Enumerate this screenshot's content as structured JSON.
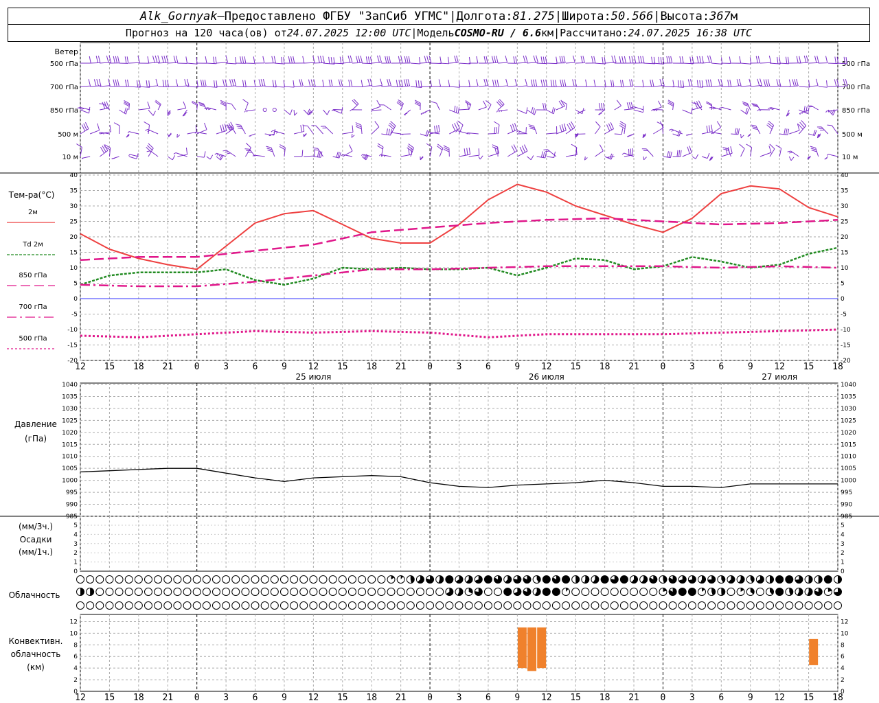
{
  "header": {
    "station": "Alk_Gornyak",
    "dash": " – ",
    "provider": "Предоставлено ФГБУ \"ЗапСиб УГМС\"",
    "sep": " | ",
    "lon_label": "Долгота: ",
    "lon": "81.275",
    "lat_label": "Широта: ",
    "lat": "50.566",
    "alt_label": "Высота: ",
    "alt": "367",
    "alt_unit": "м",
    "forecast_label": "Прогноз на 120 часа(ов) от ",
    "init_time": "24.07.2025 12:00 UTC",
    "model_label": "Модель ",
    "model": "COSMO-RU / 6.6",
    "model_unit": "км",
    "calc_label": "Рассчитано: ",
    "calc_time": "24.07.2025 16:38 UTC"
  },
  "chart_data": [
    {
      "type": "wind_barbs",
      "panel_title": "Ветер",
      "levels": [
        "500 гПа",
        "700 гПа",
        "850 гПа",
        "500 м",
        "10 м"
      ],
      "colors": {
        "barb": "#7b2fc9"
      }
    },
    {
      "type": "line",
      "ylabel": "Тем-ра(°C)",
      "ylim": [
        -20,
        40
      ],
      "yticks": [
        -20,
        -15,
        -10,
        -5,
        0,
        5,
        10,
        15,
        20,
        25,
        30,
        35,
        40
      ],
      "x_hours": [
        0,
        6,
        12,
        18,
        24,
        30,
        36,
        42,
        48,
        54,
        60,
        66,
        72,
        78
      ],
      "x_tick_labels": [
        "12",
        "15",
        "18",
        "21",
        "0",
        "3",
        "6",
        "9",
        "12",
        "15",
        "18",
        "21",
        "0",
        "3",
        "6",
        "9",
        "12",
        "15",
        "18",
        "21",
        "0",
        "3",
        "6",
        "9",
        "12",
        "15",
        "18"
      ],
      "day_labels": [
        "25 июля",
        "26 июля",
        "27 июля"
      ],
      "series": [
        {
          "name": "2м",
          "style": "solid",
          "color": "#ee4040",
          "x": [
            0,
            3,
            6,
            9,
            12,
            15,
            18,
            21,
            24,
            27,
            30,
            33,
            36,
            39,
            42,
            45,
            48,
            51,
            54,
            57,
            60,
            63,
            66,
            69,
            72,
            75,
            78
          ],
          "y": [
            21,
            16,
            13,
            11,
            9.5,
            17,
            24.5,
            27.5,
            28.5,
            24,
            19.5,
            18,
            18,
            24,
            32,
            37,
            34.5,
            30,
            27,
            24,
            21.5,
            26,
            34,
            36.5,
            35.5,
            29.5,
            26.5
          ]
        },
        {
          "name": "Td 2м",
          "style": "dashed",
          "color": "#228b22",
          "x": [
            0,
            3,
            6,
            9,
            12,
            15,
            18,
            21,
            24,
            27,
            30,
            33,
            36,
            39,
            42,
            45,
            48,
            51,
            54,
            57,
            60,
            63,
            66,
            69,
            72,
            75,
            78
          ],
          "y": [
            4.5,
            7.5,
            8.5,
            8.5,
            8.5,
            9.5,
            6,
            4.5,
            6.5,
            10,
            9.5,
            10,
            9.5,
            9.5,
            10,
            7.5,
            10,
            13,
            12.5,
            9.5,
            10.5,
            13.5,
            12,
            10,
            11,
            14.5,
            16.5
          ]
        },
        {
          "name": "850 гПа",
          "style": "longdash",
          "color": "#e0168a",
          "x": [
            0,
            6,
            12,
            18,
            24,
            30,
            36,
            42,
            48,
            54,
            60,
            66,
            72,
            78
          ],
          "y": [
            12.5,
            13.5,
            13.5,
            15.5,
            17.5,
            21.5,
            23,
            24.5,
            25.5,
            26,
            25,
            24,
            24.5,
            25.5
          ]
        },
        {
          "name": "700 гПа",
          "style": "dashdot",
          "color": "#e0168a",
          "x": [
            0,
            6,
            12,
            18,
            24,
            30,
            36,
            42,
            48,
            54,
            60,
            66,
            72,
            78
          ],
          "y": [
            4.5,
            4,
            4,
            5.5,
            7.5,
            9.5,
            9.5,
            10,
            10.5,
            10.5,
            10.5,
            10,
            10.5,
            10
          ]
        },
        {
          "name": "500 гПа",
          "style": "dotted",
          "color": "#e0168a",
          "x": [
            0,
            6,
            12,
            18,
            24,
            30,
            36,
            42,
            48,
            54,
            60,
            66,
            72,
            78
          ],
          "y": [
            -12,
            -12.5,
            -11.5,
            -10.5,
            -11,
            -10.5,
            -11,
            -12.5,
            -11.5,
            -11.5,
            -11.5,
            -11,
            -10.5,
            -10
          ]
        }
      ]
    },
    {
      "type": "line",
      "ylabel": "Давление",
      "yunit": "(гПа)",
      "ylim": [
        985,
        1040
      ],
      "yticks": [
        985,
        990,
        995,
        1000,
        1005,
        1010,
        1015,
        1020,
        1025,
        1030,
        1035,
        1040
      ],
      "series": [
        {
          "name": "",
          "color": "#000000",
          "x": [
            0,
            3,
            6,
            9,
            12,
            15,
            18,
            21,
            24,
            27,
            30,
            33,
            36,
            39,
            42,
            45,
            48,
            51,
            54,
            57,
            60,
            63,
            66,
            69,
            72,
            75,
            78
          ],
          "y": [
            1003.5,
            1004,
            1004.5,
            1005,
            1005,
            1003,
            1001,
            999.5,
            1001,
            1001.5,
            1002,
            1001.5,
            999,
            997.5,
            997,
            998,
            998.5,
            999,
            1000,
            999,
            997.5,
            997.5,
            997,
            998.5,
            998.5,
            998.5,
            998.5
          ]
        }
      ]
    },
    {
      "type": "bar",
      "ylabel": "Осадки",
      "yunit_top": "(мм/3ч.)",
      "yunit_bottom": "(мм/1ч.)",
      "ylim": [
        0,
        5
      ],
      "yticks": [
        0,
        1,
        2,
        3,
        4,
        5
      ],
      "values": []
    },
    {
      "type": "cloud_symbols",
      "ylabel": "Облачность",
      "rows": 3
    },
    {
      "type": "bar",
      "ylabel": "Конвективн. облачность (км)",
      "ylabel_lines": [
        "Конвективн.",
        "облачность",
        "(км)"
      ],
      "ylim": [
        0,
        13
      ],
      "yticks": [
        0,
        2,
        4,
        6,
        8,
        10,
        12
      ],
      "color": "#f0812c",
      "bars": [
        {
          "hour": 45.5,
          "bottom": 4,
          "top": 11
        },
        {
          "hour": 46.5,
          "bottom": 3.5,
          "top": 11
        },
        {
          "hour": 47.5,
          "bottom": 4,
          "top": 11
        },
        {
          "hour": 75.5,
          "bottom": 4.5,
          "top": 9
        }
      ]
    }
  ]
}
